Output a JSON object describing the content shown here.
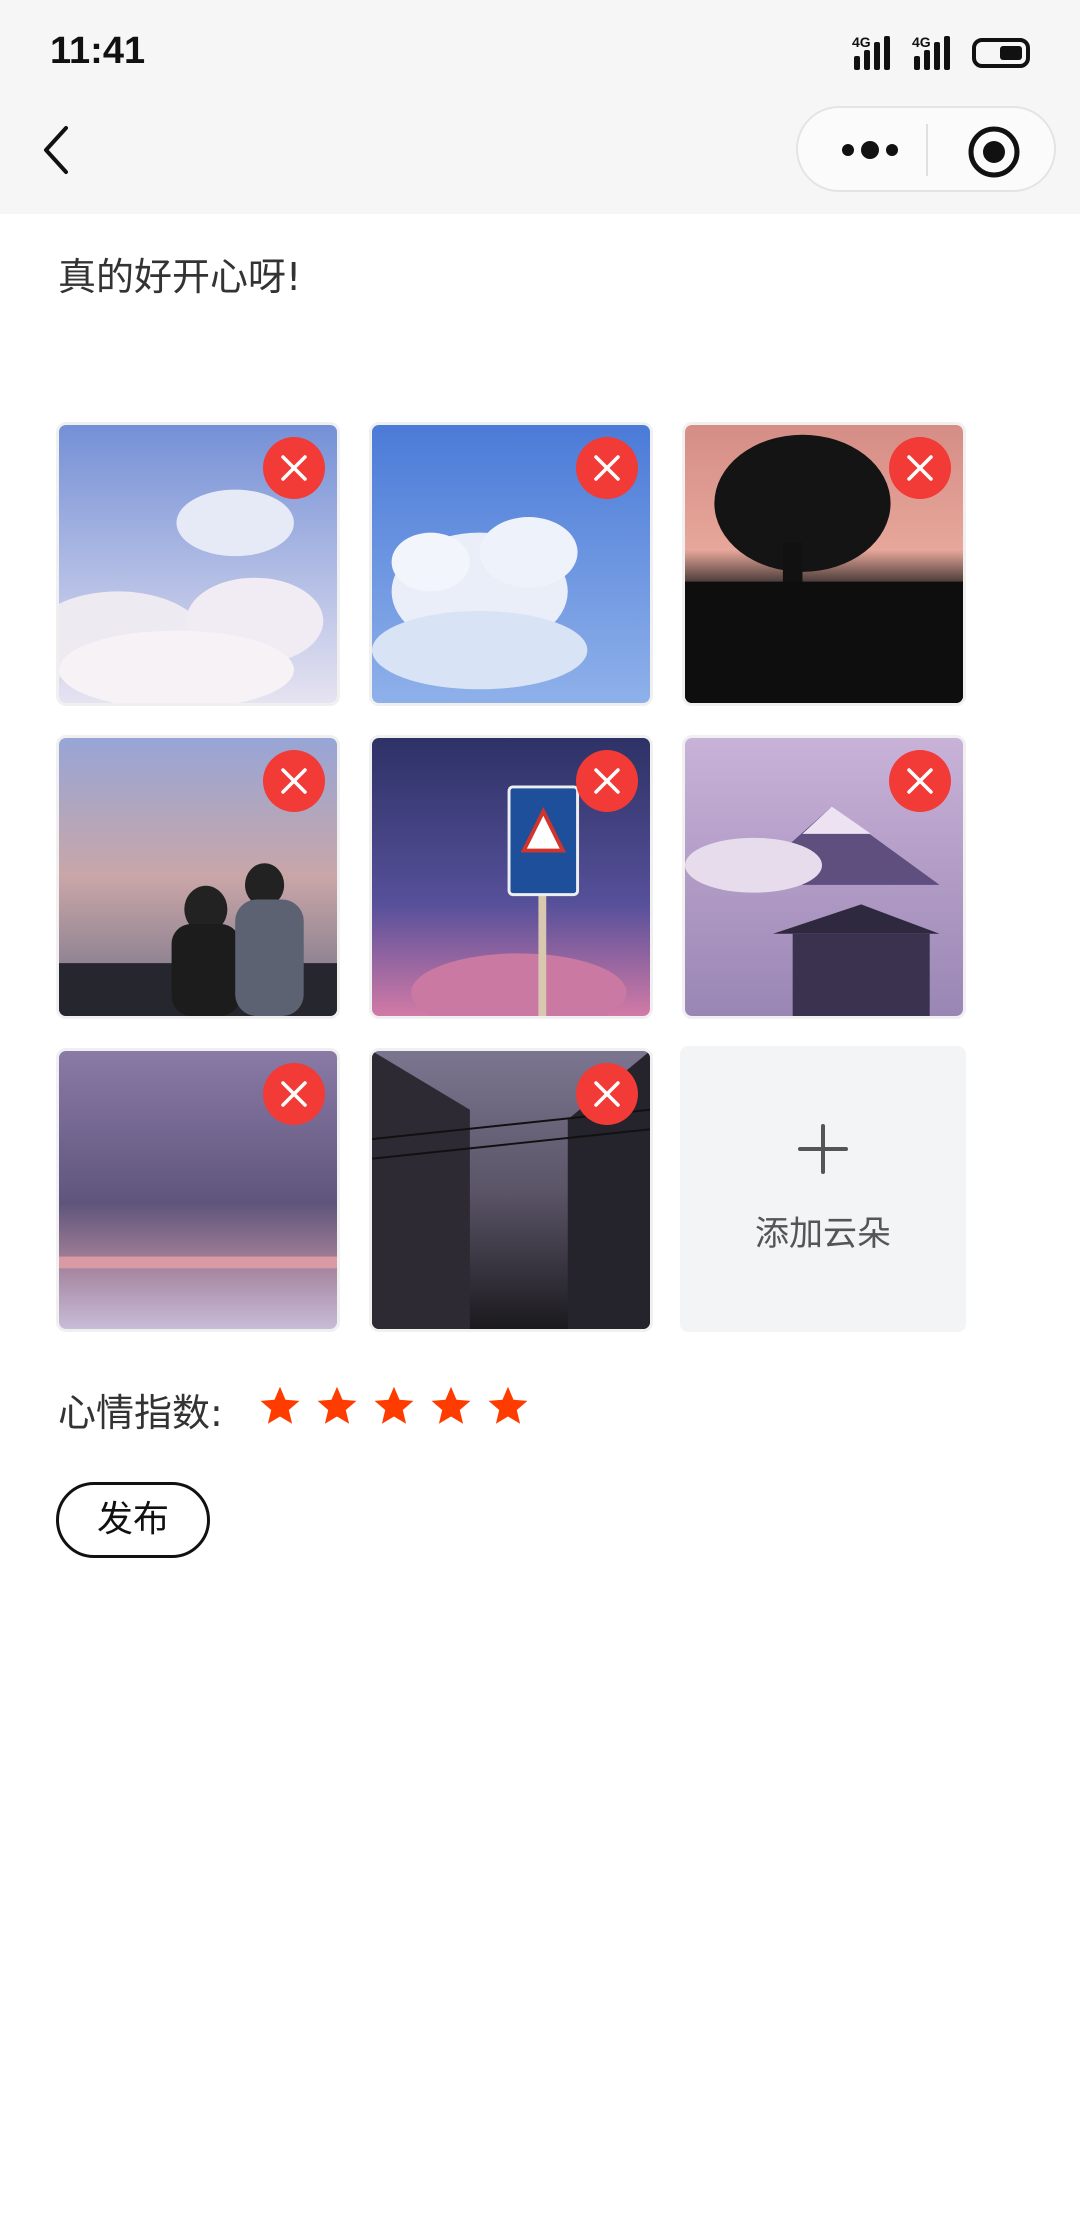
{
  "status_bar": {
    "time": "11:41",
    "signal_label_1": "4G",
    "signal_label_2": "4G",
    "icons": [
      "signal-icon",
      "signal-icon",
      "battery-icon"
    ]
  },
  "nav": {
    "icons": [
      "back-icon",
      "more-icon",
      "target-icon"
    ]
  },
  "post": {
    "text": "真的好开心呀!"
  },
  "images": [
    {
      "name": "sky-clouds-text",
      "colors": [
        "#7f9bdc",
        "#cdd7ef",
        "#f3e9ef"
      ]
    },
    {
      "name": "blue-sky-cloud",
      "colors": [
        "#4f7fd9",
        "#a9c3ee",
        "#e9f0fb"
      ]
    },
    {
      "name": "tree-sunset",
      "colors": [
        "#e7a08f",
        "#2b2b2b",
        "#0c0c0c"
      ]
    },
    {
      "name": "couple-evening",
      "colors": [
        "#a9b3d8",
        "#caa4a4",
        "#1d1d24"
      ]
    },
    {
      "name": "sign-night-sky",
      "colors": [
        "#2b2f63",
        "#5b4f8f",
        "#c86a9d"
      ]
    },
    {
      "name": "mountain-house",
      "colors": [
        "#b9a0c8",
        "#e4d6ea",
        "#2c2744"
      ]
    },
    {
      "name": "purple-sea",
      "colors": [
        "#6b5f87",
        "#8e7ca2",
        "#c7b8d6"
      ]
    },
    {
      "name": "city-street-dusk",
      "colors": [
        "#6d6780",
        "#2a2730",
        "#141316"
      ]
    }
  ],
  "add_image": {
    "label": "添加云朵",
    "icon": "plus-icon"
  },
  "mood": {
    "label": "心情指数:",
    "rating": 5,
    "max": 5,
    "star_color": "#ff3c00"
  },
  "publish_button": {
    "label": "发布"
  },
  "colors": {
    "delete_badge": "#f23a36",
    "header_bg": "#f6f6f6"
  }
}
